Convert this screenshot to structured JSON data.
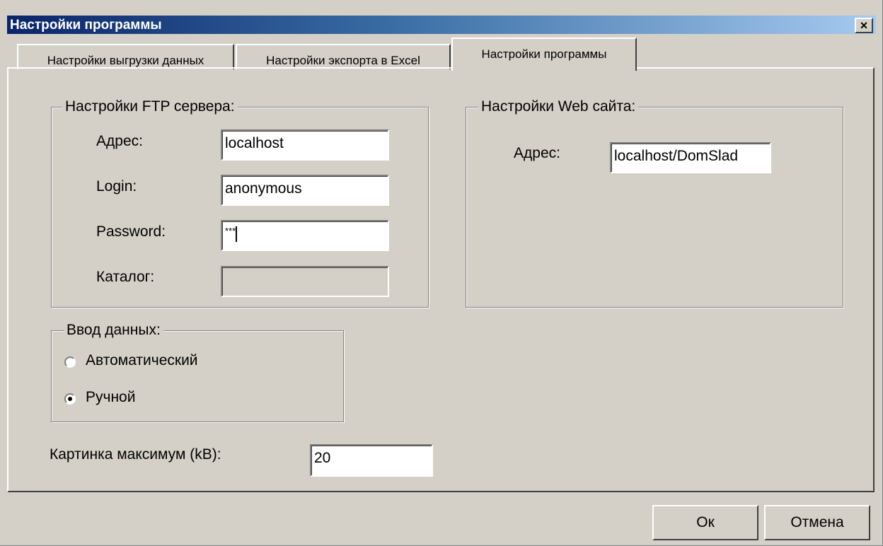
{
  "window": {
    "title": "Настройки программы",
    "close_glyph": "×"
  },
  "tabs": [
    {
      "label": "Настройки выгрузки данных",
      "active": false
    },
    {
      "label": "Настройки экспорта в Excel",
      "active": false
    },
    {
      "label": "Настройки программы",
      "active": true
    }
  ],
  "ftp_group": {
    "title": "Настройки FTP сервера:",
    "address_label": "Адрес:",
    "address_value": "localhost",
    "login_label": "Login:",
    "login_value": "anonymous",
    "password_label": "Password:",
    "password_value": "***",
    "catalog_label": "Каталог:",
    "catalog_value": ""
  },
  "web_group": {
    "title": "Настройки Web сайта:",
    "address_label": "Адрес:",
    "address_value": "localhost/DomSlad"
  },
  "input_group": {
    "title": "Ввод данных:",
    "options": [
      {
        "label": "Автоматический",
        "selected": false
      },
      {
        "label": "Ручной",
        "selected": true
      }
    ]
  },
  "image_max": {
    "label": "Картинка максимум (kB):",
    "value": "20"
  },
  "buttons": {
    "ok_label": "Ок",
    "cancel_label": "Отмена"
  },
  "colors": {
    "face": "#d4d0c8",
    "title_start": "#0a246a",
    "title_end": "#a6caf0"
  }
}
